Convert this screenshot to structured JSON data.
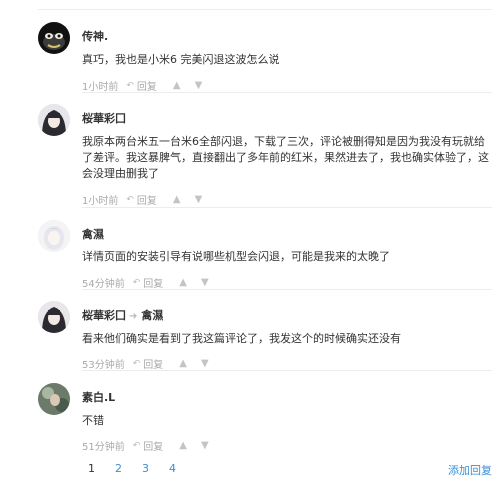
{
  "comments": [
    {
      "author": "传神.",
      "reply_to": "",
      "content": "真巧，我也是小米6 完美闪退这波怎么说",
      "time": "1小时前",
      "reply_label": "回复"
    },
    {
      "author": "桜華彩囗",
      "reply_to": "",
      "content": "我原本两台米五一台米6全部闪退，下载了三次，评论被删得知是因为我没有玩就给了差评。我这暴脾气，直接翻出了多年前的红米，果然进去了，我也确实体验了，这会没理由删我了",
      "time": "1小时前",
      "reply_label": "回复"
    },
    {
      "author": "禽濕",
      "reply_to": "",
      "content": "详情页面的安装引导有说哪些机型会闪退，可能是我来的太晚了",
      "time": "54分钟前",
      "reply_label": "回复"
    },
    {
      "author": "桜華彩囗",
      "reply_to": "禽濕",
      "content": "看来他们确实是看到了我这篇评论了，我发这个的时候确实还没有",
      "time": "53分钟前",
      "reply_label": "回复"
    },
    {
      "author": "素白.L",
      "reply_to": "",
      "content": "不错",
      "time": "51分钟前",
      "reply_label": "回复"
    }
  ],
  "pagination": {
    "pages": [
      "1",
      "2",
      "3",
      "4"
    ],
    "current": "1"
  },
  "add_reply_label": "添加回复",
  "colors": {
    "link": "#3a8ed4",
    "meta": "#aaaaaa",
    "text": "#333333"
  },
  "icons": {
    "reply": "reply-arrow-icon",
    "like": "thumbs-up-icon",
    "dislike": "thumbs-down-icon"
  }
}
